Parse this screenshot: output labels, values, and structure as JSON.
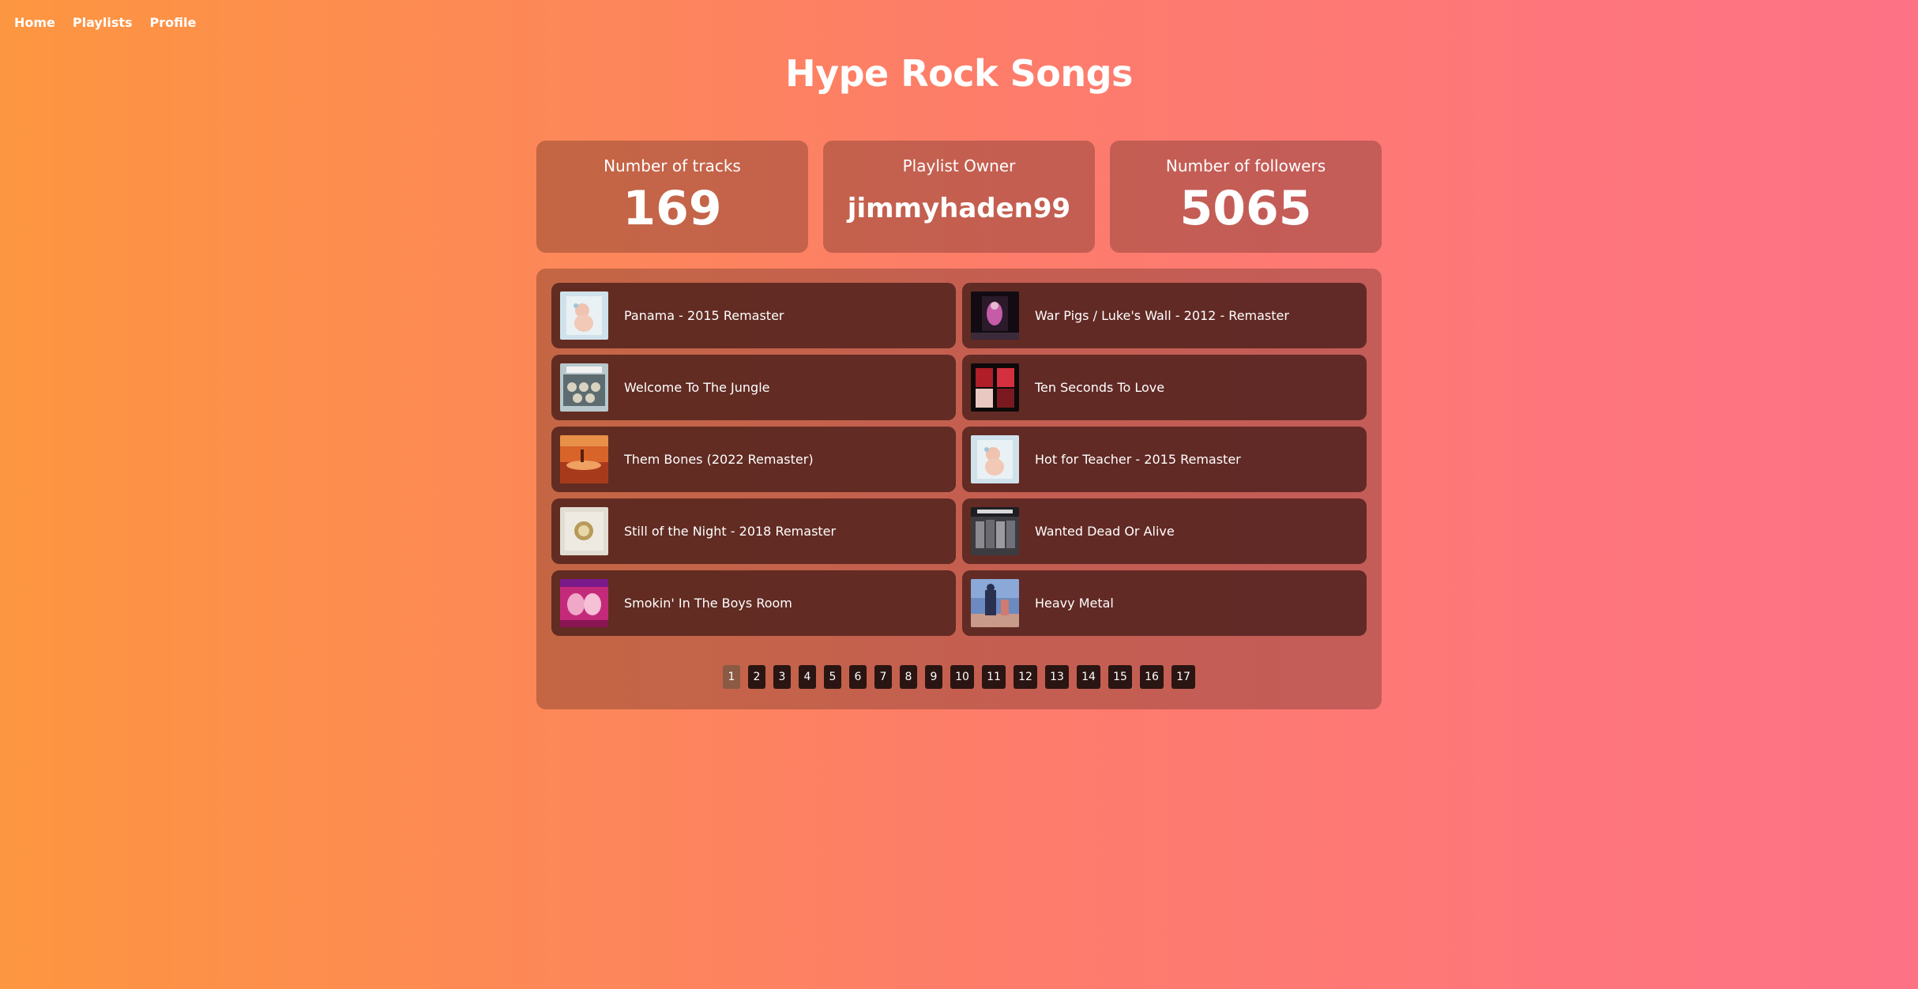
{
  "colors": {
    "gradient_left": "#fd9640",
    "gradient_mid": "#fd7d69",
    "gradient_right": "#fe7286",
    "card_bg": "rgba(90,40,35,0.35)",
    "track_bg": "rgba(70,28,24,0.78)",
    "page_active": "#8a5a44",
    "page_inactive": "#2a1512"
  },
  "nav": {
    "home": "Home",
    "playlists": "Playlists",
    "profile": "Profile"
  },
  "playlist": {
    "title": "Hype Rock Songs"
  },
  "stats": {
    "tracks_label": "Number of tracks",
    "tracks_value": "169",
    "owner_label": "Playlist Owner",
    "owner_value": "jimmyhaden99",
    "followers_label": "Number of followers",
    "followers_value": "5065"
  },
  "tracks": [
    {
      "name": "Panama - 2015 Remaster",
      "cover": "baby-cherub-album-cover"
    },
    {
      "name": "War Pigs / Luke's Wall - 2012 - Remaster",
      "cover": "dark-figure-album-cover"
    },
    {
      "name": "Welcome To The Jungle",
      "cover": "gnr-cross-album-cover"
    },
    {
      "name": "Ten Seconds To Love",
      "cover": "band-photo-album-cover"
    },
    {
      "name": "Them Bones (2022 Remaster)",
      "cover": "desert-sunset-album-cover"
    },
    {
      "name": "Hot for Teacher - 2015 Remaster",
      "cover": "baby-cherub-album-cover"
    },
    {
      "name": "Still of the Night - 2018 Remaster",
      "cover": "serpent-emblem-album-cover"
    },
    {
      "name": "Wanted Dead Or Alive",
      "cover": "bon-jovi-album-cover"
    },
    {
      "name": "Smokin' In The Boys Room",
      "cover": "pink-faces-album-cover"
    },
    {
      "name": "Heavy Metal",
      "cover": "blue-figure-album-cover"
    }
  ],
  "pagination": {
    "current": "1",
    "pages": [
      "1",
      "2",
      "3",
      "4",
      "5",
      "6",
      "7",
      "8",
      "9",
      "10",
      "11",
      "12",
      "13",
      "14",
      "15",
      "16",
      "17"
    ]
  }
}
